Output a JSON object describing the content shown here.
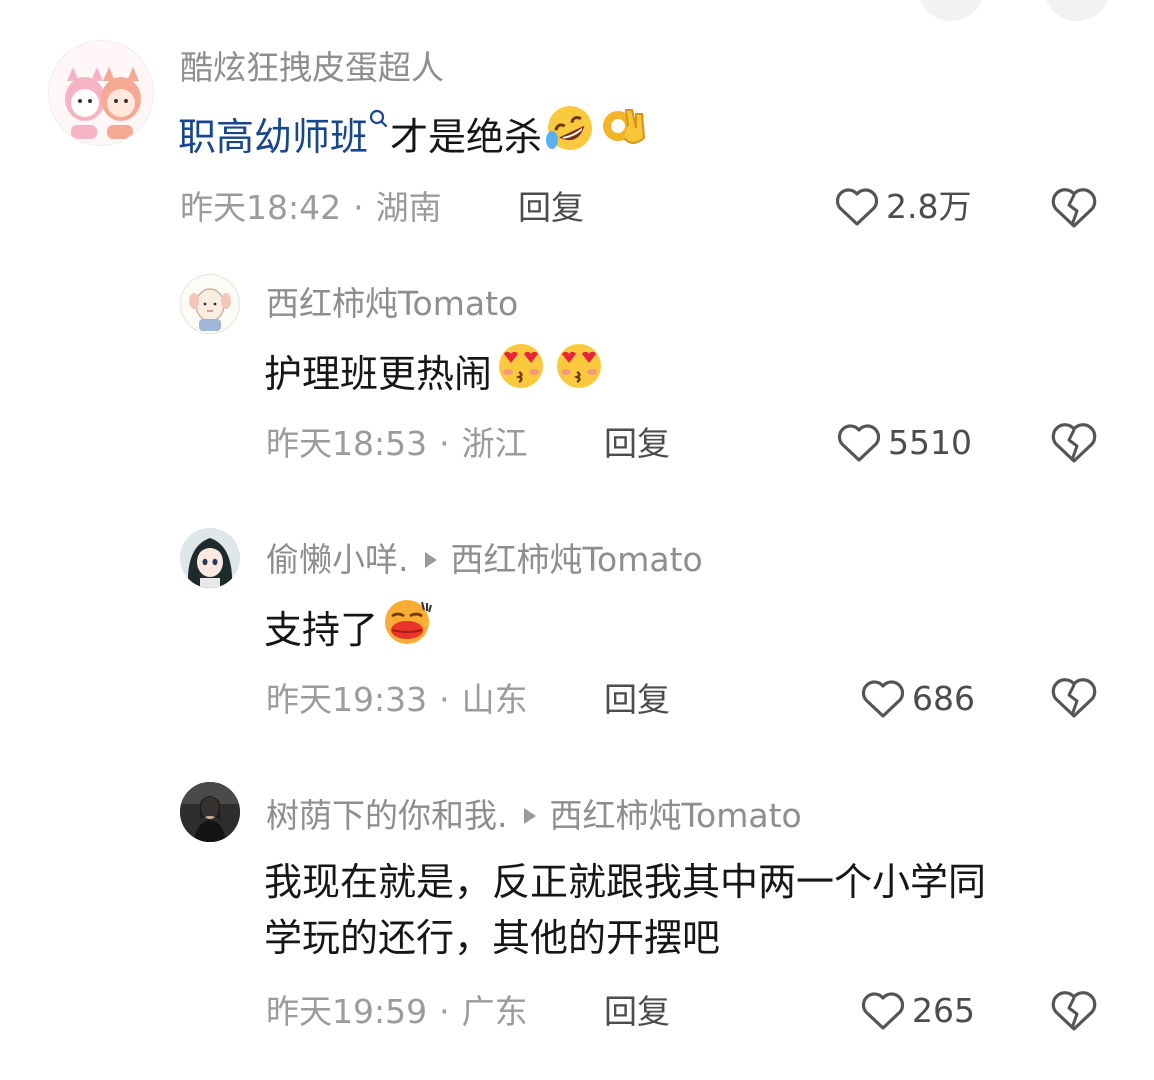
{
  "comments": [
    {
      "name": "酷炫狂拽皮蛋超人",
      "tag": "职高幼师班",
      "text": "才是绝杀",
      "time": "昨天18:42",
      "location": "湖南",
      "reply": "回复",
      "likes": "2.8万",
      "emojis": [
        "rofl-face-icon",
        "ok-hand-icon"
      ]
    },
    {
      "name": "西红柿炖Tomato",
      "text": "护理班更热闹",
      "time": "昨天18:53",
      "location": "浙江",
      "reply": "回复",
      "likes": "5510",
      "emojis": [
        "heart-eyes-kiss-icon",
        "heart-eyes-kiss-icon"
      ]
    },
    {
      "name": "偷懒小咩.",
      "reply_to": "西红柿炖Tomato",
      "text": "支持了",
      "time": "昨天19:33",
      "location": "山东",
      "reply": "回复",
      "likes": "686",
      "emojis": [
        "kissing-lips-icon"
      ]
    },
    {
      "name": "树荫下的你和我.",
      "reply_to": "西红柿炖Tomato",
      "text_line1": "我现在就是，反正就跟我其中两一个小学同",
      "text_line2": "学玩的还行，其他的开摆吧",
      "time": "昨天19:59",
      "location": "广东",
      "reply": "回复",
      "likes": "265"
    }
  ],
  "separator": "·",
  "colors": {
    "name": "#8e8e8e",
    "text": "#161616",
    "tag": "#17468f",
    "meta": "#9b9b9b",
    "action": "#4c4c4c"
  }
}
